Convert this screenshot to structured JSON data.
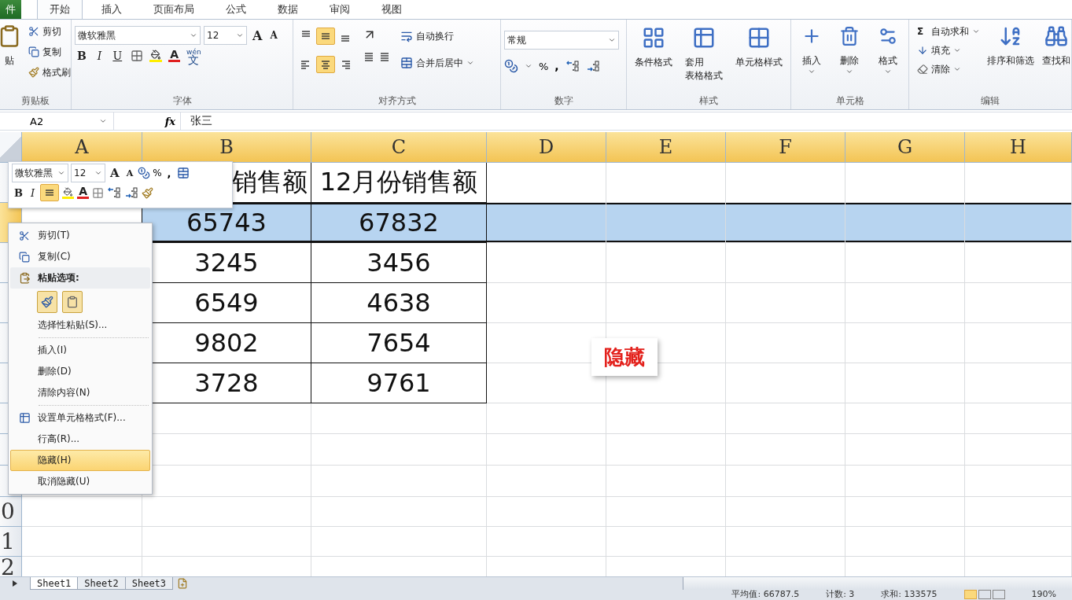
{
  "ribbon_tabs": [
    {
      "label": "件",
      "selected": false,
      "kind": "file"
    },
    {
      "label": "开始",
      "selected": true,
      "kind": "tab"
    },
    {
      "label": "插入",
      "selected": false,
      "kind": "tab"
    },
    {
      "label": "页面布局",
      "selected": false,
      "kind": "tab"
    },
    {
      "label": "公式",
      "selected": false,
      "kind": "tab"
    },
    {
      "label": "数据",
      "selected": false,
      "kind": "tab"
    },
    {
      "label": "审阅",
      "selected": false,
      "kind": "tab"
    },
    {
      "label": "视图",
      "selected": false,
      "kind": "tab"
    }
  ],
  "clipboard": {
    "title": "剪贴板",
    "paste": "贴",
    "cut": "剪切",
    "copy": "复制",
    "format_painter": "格式刷"
  },
  "font": {
    "title": "字体",
    "name": "微软雅黑",
    "size": "12",
    "grow": "A",
    "shrink": "A",
    "bold": "B",
    "italic": "I",
    "underline": "U",
    "font_color": "A",
    "phonetic_top": "wén",
    "phonetic": "文"
  },
  "alignment": {
    "title": "对齐方式",
    "vertical": [
      {
        "selected": false
      },
      {
        "selected": true
      },
      {
        "selected": false
      }
    ],
    "horizontal": [
      {
        "selected": false
      },
      {
        "selected": true
      },
      {
        "selected": false
      }
    ],
    "wrap": "自动换行",
    "merge": "合并后居中"
  },
  "number": {
    "title": "数字",
    "format": "常规",
    "percent": "%",
    "comma": ","
  },
  "styles": {
    "title": "样式",
    "buttons": [
      {
        "lines": [
          "条件格式"
        ]
      },
      {
        "lines": [
          "套用",
          "表格格式"
        ]
      },
      {
        "lines": [
          "单元格样式"
        ]
      }
    ]
  },
  "cells": {
    "title": "单元格",
    "buttons": [
      "插入",
      "删除",
      "格式"
    ]
  },
  "editing": {
    "title": "编辑",
    "sum_sign": "Σ",
    "small": [
      "自动求和",
      "填充",
      "清除"
    ],
    "large": [
      "排序和筛选",
      "查找和"
    ]
  },
  "formula_bar": {
    "name_box": "A2",
    "function_label": "fx",
    "value": "张三"
  },
  "columns": [
    {
      "label": "A",
      "highlighted": true
    },
    {
      "label": "B",
      "highlighted": true
    },
    {
      "label": "C",
      "highlighted": true
    },
    {
      "label": "D",
      "highlighted": true
    },
    {
      "label": "E",
      "highlighted": true
    },
    {
      "label": "F",
      "highlighted": true
    },
    {
      "label": "G",
      "highlighted": true
    },
    {
      "label": "H",
      "highlighted": true
    }
  ],
  "rows": [
    {
      "selected": false,
      "cells": [
        null,
        "销售额",
        "12月份销售额"
      ]
    },
    {
      "selected": true,
      "cells": [
        null,
        "65743",
        "67832"
      ]
    },
    {
      "selected": false,
      "cells": [
        null,
        "3245",
        "3456"
      ]
    },
    {
      "selected": false,
      "cells": [
        null,
        "6549",
        "4638"
      ]
    },
    {
      "selected": false,
      "cells": [
        null,
        "9802",
        "7654"
      ]
    },
    {
      "selected": false,
      "cells": [
        null,
        "3728",
        "9761"
      ]
    },
    {
      "selected": false
    },
    {
      "selected": false
    },
    {
      "selected": false
    },
    {
      "number": "0",
      "selected": false
    },
    {
      "number": "1",
      "selected": false
    },
    {
      "number": "2",
      "selected": false
    }
  ],
  "mini_toolbar": {
    "font": "微软雅黑",
    "size": "12",
    "grow": "A",
    "shrink": "A",
    "percent": "%",
    "comma": ",",
    "bold": "B",
    "italic": "I",
    "font_color": "A",
    "center_selected": true
  },
  "context_menu": [
    {
      "kind": "cut",
      "label": "剪切(T)",
      "selected": false
    },
    {
      "kind": "copy",
      "label": "复制(C)",
      "selected": false
    },
    {
      "kind": "header",
      "label": "粘贴选项:",
      "selected": false
    },
    {
      "kind": "paste_options",
      "selected": false
    },
    {
      "kind": "item",
      "label": "选择性粘贴(S)...",
      "selected": false
    },
    {
      "kind": "separator"
    },
    {
      "kind": "item",
      "label": "插入(I)",
      "selected": false
    },
    {
      "kind": "item",
      "label": "删除(D)",
      "selected": false
    },
    {
      "kind": "item",
      "label": "清除内容(N)",
      "selected": false
    },
    {
      "kind": "separator"
    },
    {
      "kind": "format",
      "label": "设置单元格格式(F)...",
      "selected": false
    },
    {
      "kind": "item",
      "label": "行高(R)...",
      "selected": false
    },
    {
      "kind": "item",
      "label": "隐藏(H)",
      "selected": true
    },
    {
      "kind": "item",
      "label": "取消隐藏(U)",
      "selected": false
    }
  ],
  "callout": "隐藏",
  "sheet_tabs": [
    {
      "label": "Sheet1",
      "selected": true
    },
    {
      "label": "Sheet2",
      "selected": false
    },
    {
      "label": "Sheet3",
      "selected": false
    }
  ],
  "status_bar": {
    "stats": [
      "平均值: 66787.5",
      "计数: 3",
      "求和: 133575"
    ],
    "views": [
      {
        "selected": true
      },
      {
        "selected": false
      },
      {
        "selected": false
      }
    ],
    "zoom": "190%"
  }
}
